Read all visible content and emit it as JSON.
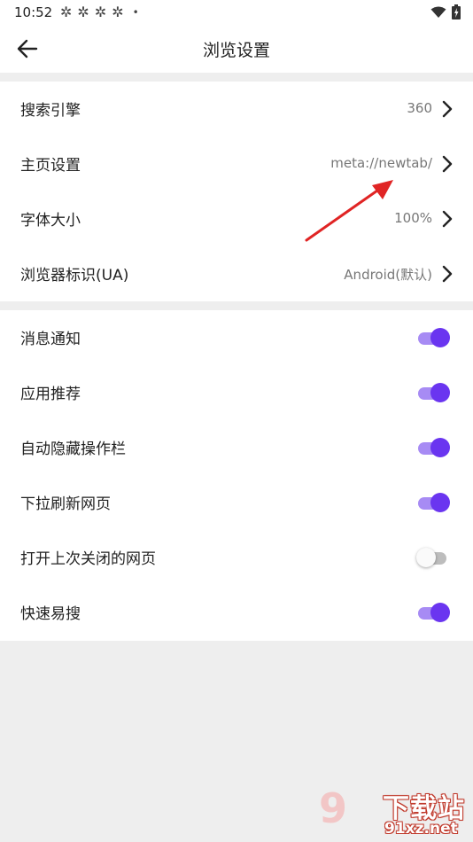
{
  "status_bar": {
    "time": "10:52",
    "notification_icons": [
      "app-icon",
      "app-icon",
      "app-icon",
      "app-icon"
    ],
    "dot": "•"
  },
  "app_bar": {
    "title": "浏览设置"
  },
  "general_settings": [
    {
      "label": "搜索引擎",
      "value": "360"
    },
    {
      "label": "主页设置",
      "value": "meta://newtab/"
    },
    {
      "label": "字体大小",
      "value": "100%"
    },
    {
      "label": "浏览器标识(UA)",
      "value": "Android(默认)"
    }
  ],
  "toggle_settings": [
    {
      "label": "消息通知",
      "on": true
    },
    {
      "label": "应用推荐",
      "on": true
    },
    {
      "label": "自动隐藏操作栏",
      "on": true
    },
    {
      "label": "下拉刷新网页",
      "on": true
    },
    {
      "label": "打开上次关闭的网页",
      "on": false
    },
    {
      "label": "快速易搜",
      "on": true
    }
  ],
  "watermark": {
    "logo_text": "9",
    "site_name": "下载站",
    "url": "91xz.net"
  },
  "colors": {
    "accent": "#6a35f0",
    "track_on": "#a78bf4",
    "annotation_arrow": "#e02424"
  }
}
